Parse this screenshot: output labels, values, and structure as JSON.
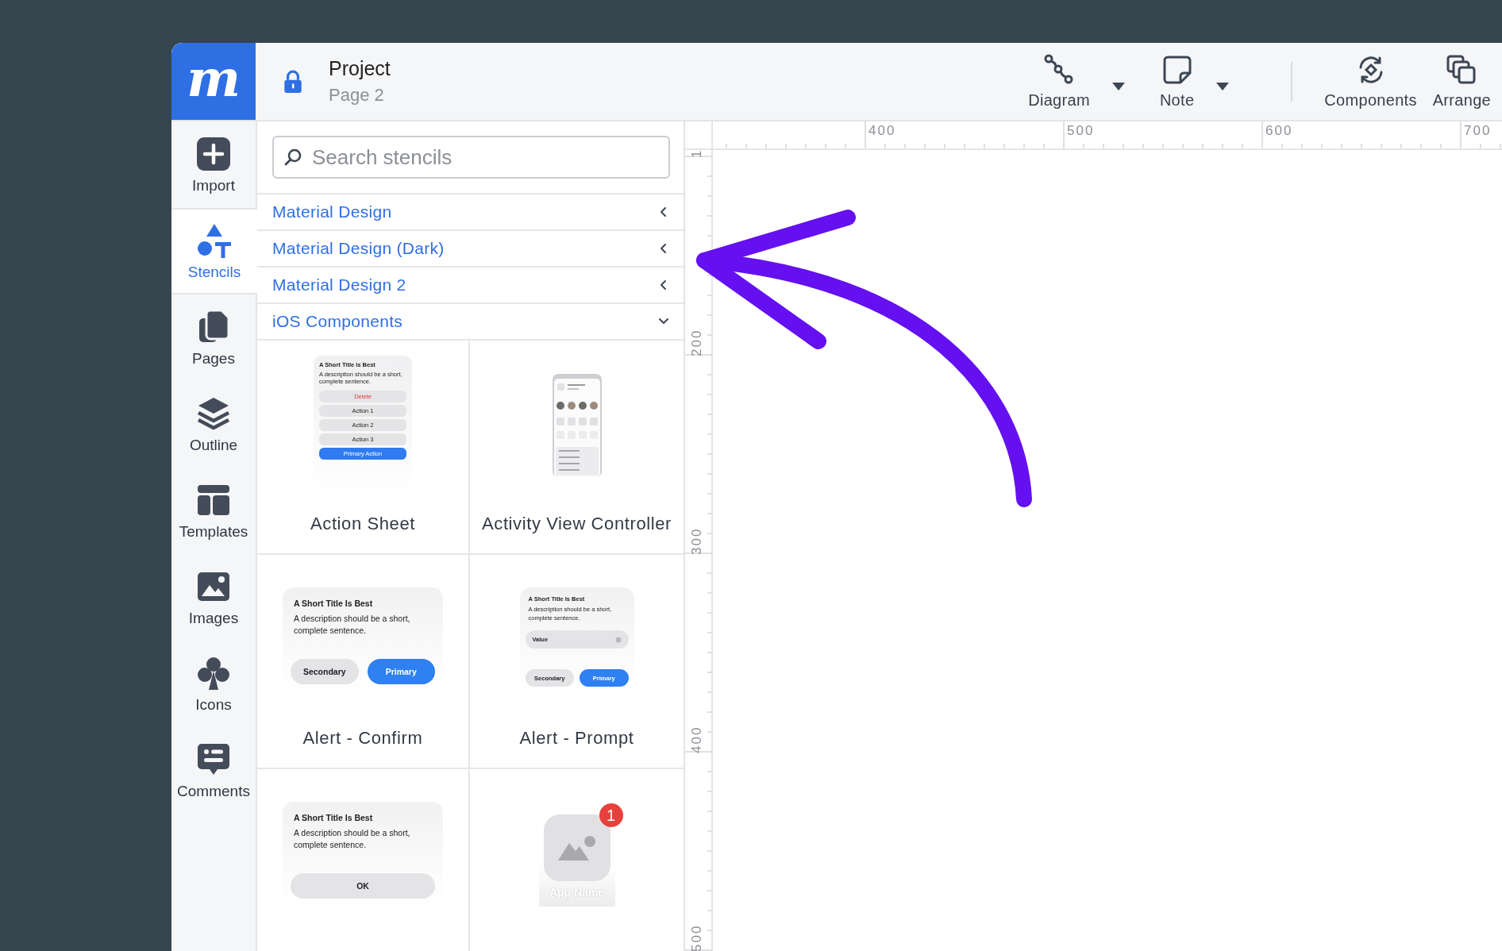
{
  "header": {
    "logo": "m",
    "project": "Project",
    "page": "Page 2",
    "locked": true
  },
  "toolbar": {
    "groups": [
      {
        "tools": [
          {
            "label": "Diagram",
            "dropdown": true
          },
          {
            "label": "Note",
            "dropdown": true
          }
        ]
      },
      {
        "tools": [
          {
            "label": "Components",
            "dropdown": false
          },
          {
            "label": "Arrange",
            "dropdown": false
          }
        ]
      }
    ]
  },
  "sidebar": {
    "items": [
      {
        "label": "Import",
        "selected": false
      },
      {
        "label": "Stencils",
        "selected": true
      },
      {
        "label": "Pages",
        "selected": false
      },
      {
        "label": "Outline",
        "selected": false
      },
      {
        "label": "Templates",
        "selected": false
      },
      {
        "label": "Images",
        "selected": false
      },
      {
        "label": "Icons",
        "selected": false
      },
      {
        "label": "Comments",
        "selected": false
      }
    ]
  },
  "search": {
    "placeholder": "Search stencils"
  },
  "categories": [
    {
      "label": "Material Design",
      "expanded": false
    },
    {
      "label": "Material Design (Dark)",
      "expanded": false
    },
    {
      "label": "Material Design 2",
      "expanded": false
    },
    {
      "label": "iOS Components",
      "expanded": true
    }
  ],
  "stencils": [
    {
      "kind": "action-sheet",
      "label": "Action Sheet",
      "title": "A Short Title is Best",
      "description": "A description should be a short, complete sentence.",
      "destructive": "Delete",
      "actions": [
        "Action 1",
        "Action 2",
        "Action 3"
      ],
      "primary": "Primary Action"
    },
    {
      "kind": "activity",
      "label": "Activity View Controller"
    },
    {
      "kind": "alert",
      "label": "Alert - Confirm",
      "title": "A Short Title Is Best",
      "description": "A description should be a short, complete sentence.",
      "buttons": [
        {
          "label": "Secondary",
          "primary": false
        },
        {
          "label": "Primary",
          "primary": true
        }
      ]
    },
    {
      "kind": "alert",
      "label": "Alert - Prompt",
      "title": "A Short Title Is Best",
      "description": "A description should be a short, complete sentence.",
      "value": "Value",
      "buttons": [
        {
          "label": "Secondary",
          "primary": false
        },
        {
          "label": "Primary",
          "primary": true
        }
      ]
    },
    {
      "kind": "alert",
      "title": "A Short Title Is Best",
      "description": "A description should be a short, complete sentence.",
      "buttons": [
        {
          "label": "OK",
          "primary": false
        }
      ]
    },
    {
      "kind": "app-icon",
      "name": "App Name",
      "badge": "1"
    }
  ],
  "rulers": {
    "horizontal": [
      "400",
      "500",
      "600",
      "700"
    ],
    "vertical": [
      "1",
      "200",
      "300",
      "400",
      "500"
    ]
  }
}
